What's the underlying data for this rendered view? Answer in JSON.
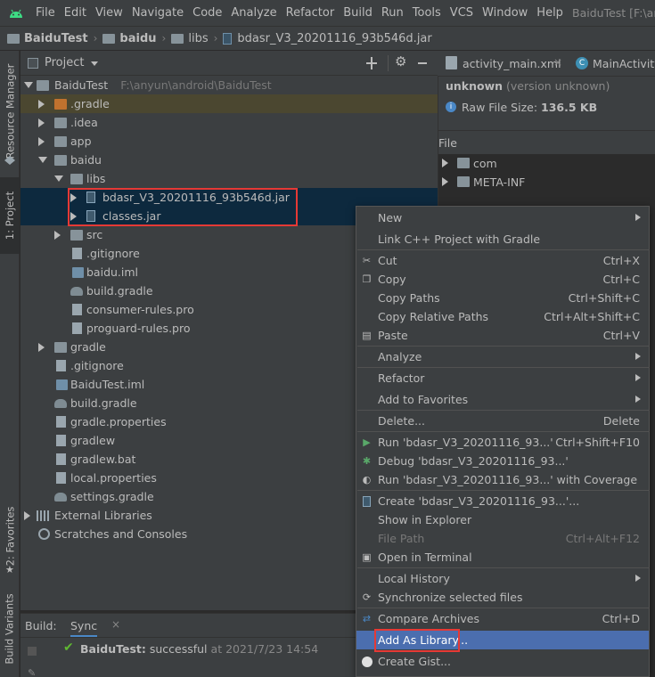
{
  "menubar": {
    "items": [
      "File",
      "Edit",
      "View",
      "Navigate",
      "Code",
      "Analyze",
      "Refactor",
      "Build",
      "Run",
      "Tools",
      "VCS",
      "Window",
      "Help"
    ],
    "window_title": "BaiduTest [F:\\an"
  },
  "breadcrumb": {
    "items": [
      "BaiduTest",
      "baidu",
      "libs",
      "bdasr_V3_20201116_93b546d.jar"
    ]
  },
  "left_strip": {
    "resource_manager": "Resource Manager",
    "project": "1: Project",
    "favorites": "2: Favorites",
    "build_variants": "Build Variants"
  },
  "project_panel": {
    "title": "Project",
    "tree": [
      {
        "label": "BaiduTest",
        "path": "F:\\anyun\\android\\BaiduTest"
      },
      {
        "label": ".gradle"
      },
      {
        "label": ".idea"
      },
      {
        "label": "app"
      },
      {
        "label": "baidu"
      },
      {
        "label": "libs"
      },
      {
        "label": "bdasr_V3_20201116_93b546d.jar"
      },
      {
        "label": "classes.jar"
      },
      {
        "label": "src"
      },
      {
        "label": ".gitignore"
      },
      {
        "label": "baidu.iml"
      },
      {
        "label": "build.gradle"
      },
      {
        "label": "consumer-rules.pro"
      },
      {
        "label": "proguard-rules.pro"
      },
      {
        "label": "gradle"
      },
      {
        "label": ".gitignore"
      },
      {
        "label": "BaiduTest.iml"
      },
      {
        "label": "build.gradle"
      },
      {
        "label": "gradle.properties"
      },
      {
        "label": "gradlew"
      },
      {
        "label": "gradlew.bat"
      },
      {
        "label": "local.properties"
      },
      {
        "label": "settings.gradle"
      },
      {
        "label": "External Libraries"
      },
      {
        "label": "Scratches and Consoles"
      }
    ]
  },
  "build_panel": {
    "build_label": "Build:",
    "sync_tab": "Sync",
    "project": "BaiduTest:",
    "status": "successful",
    "time": "at 2021/7/23 14:54"
  },
  "editor": {
    "tabs": [
      "activity_main.xml",
      "MainActivity."
    ],
    "name": "unknown",
    "version": "(version unknown)",
    "size_label": "Raw File Size:",
    "size_value": "136.5 KB",
    "file_header": "File",
    "entries": [
      "com",
      "META-INF"
    ]
  },
  "context_menu": {
    "items": [
      {
        "label": "New",
        "shortcut": ""
      },
      {
        "label": "Link C++ Project with Gradle",
        "shortcut": ""
      },
      {
        "label": "Cut",
        "shortcut": "Ctrl+X"
      },
      {
        "label": "Copy",
        "shortcut": "Ctrl+C"
      },
      {
        "label": "Copy Paths",
        "shortcut": "Ctrl+Shift+C"
      },
      {
        "label": "Copy Relative Paths",
        "shortcut": "Ctrl+Alt+Shift+C"
      },
      {
        "label": "Paste",
        "shortcut": "Ctrl+V"
      },
      {
        "label": "Analyze",
        "shortcut": ""
      },
      {
        "label": "Refactor",
        "shortcut": ""
      },
      {
        "label": "Add to Favorites",
        "shortcut": ""
      },
      {
        "label": "Delete...",
        "shortcut": "Delete"
      },
      {
        "label": "Run 'bdasr_V3_20201116_93...'",
        "shortcut": "Ctrl+Shift+F10"
      },
      {
        "label": "Debug 'bdasr_V3_20201116_93...'",
        "shortcut": ""
      },
      {
        "label": "Run 'bdasr_V3_20201116_93...' with Coverage",
        "shortcut": ""
      },
      {
        "label": "Create 'bdasr_V3_20201116_93...'...",
        "shortcut": ""
      },
      {
        "label": "Show in Explorer",
        "shortcut": ""
      },
      {
        "label": "File Path",
        "shortcut": "Ctrl+Alt+F12"
      },
      {
        "label": "Open in Terminal",
        "shortcut": ""
      },
      {
        "label": "Local History",
        "shortcut": ""
      },
      {
        "label": "Synchronize selected files",
        "shortcut": ""
      },
      {
        "label": "Compare Archives",
        "shortcut": "Ctrl+D"
      },
      {
        "label": "Add As Library...",
        "shortcut": ""
      },
      {
        "label": "Create Gist...",
        "shortcut": ""
      }
    ]
  },
  "colors": {
    "background": "#2b2b2b",
    "panel": "#3c3f41",
    "selection": "#0d293e",
    "highlight": "#4b6eaf",
    "annotation_red": "#e53935",
    "success_green": "#5fb832"
  }
}
